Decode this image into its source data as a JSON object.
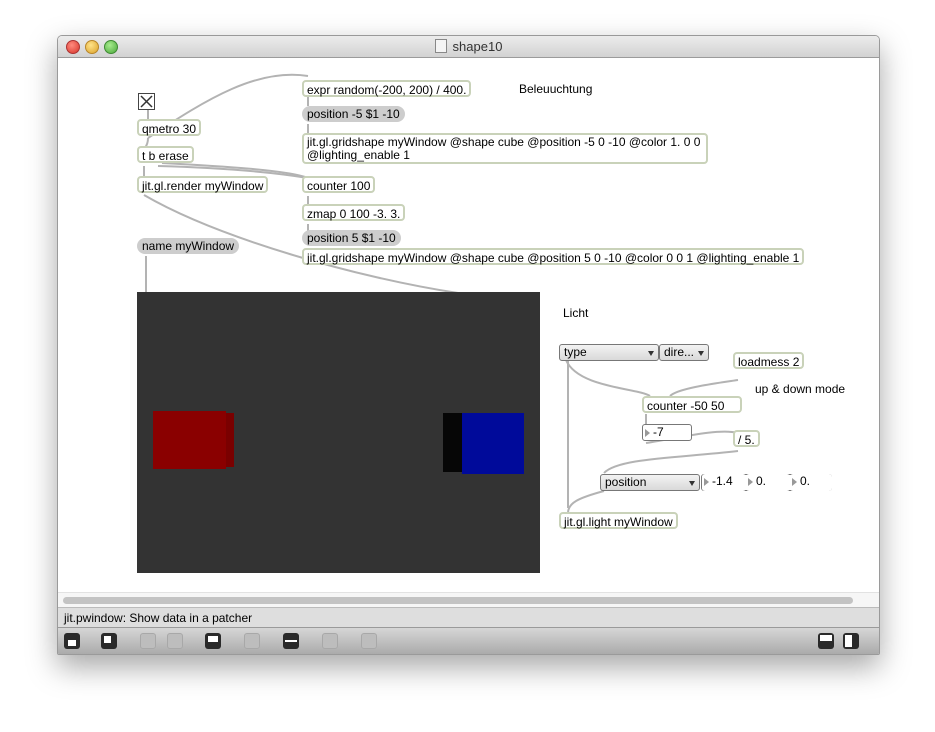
{
  "window": {
    "title": "shape10"
  },
  "objects": {
    "expr": "expr random(-200, 200) / 400.",
    "pos_red_msg": "position -5 $1 -10",
    "gridshape_red": "jit.gl.gridshape myWindow @shape cube @position -5 0 -10 @color 1. 0 0 @lighting_enable 1",
    "qmetro": "qmetro 30",
    "t_b_erase": "t b erase",
    "render": "jit.gl.render myWindow",
    "counter100": "counter 100",
    "zmap": "zmap 0 100 -3. 3.",
    "name_msg": "name myWindow",
    "pos_blue_msg": "position 5 $1 -10",
    "gridshape_blue": "jit.gl.gridshape myWindow @shape cube @position 5 0 -10 @color 0 0 1 @lighting_enable 1",
    "loadmess": "loadmess 2",
    "counter50": "counter -50 50",
    "div5": "/ 5.",
    "light": "jit.gl.light myWindow"
  },
  "comments": {
    "beleuchtung": "Beleuuchtung",
    "licht": "Licht",
    "updown": "up & down mode"
  },
  "ui": {
    "type_menu": "type",
    "dir_menu": "dire...",
    "number_main": "-7",
    "position_menu": "position",
    "num_x": "-1.4",
    "num_y": "0.",
    "num_z": "0."
  },
  "status": {
    "text": "jit.pwindow: Show data in a patcher"
  },
  "toolbar": [
    "lock-icon",
    "presentation-icon",
    "edit-icon",
    "delete-icon",
    "inspector-icon",
    "info-icon",
    "connect-icon",
    "grid-icon",
    "gear-icon",
    "split-icon",
    "panel-icon"
  ],
  "colors": {
    "cube_red": "#8a0000",
    "cube_blue": "#000a9a",
    "pwindow_bg": "#333333",
    "object_border": "#c9d2b9"
  }
}
